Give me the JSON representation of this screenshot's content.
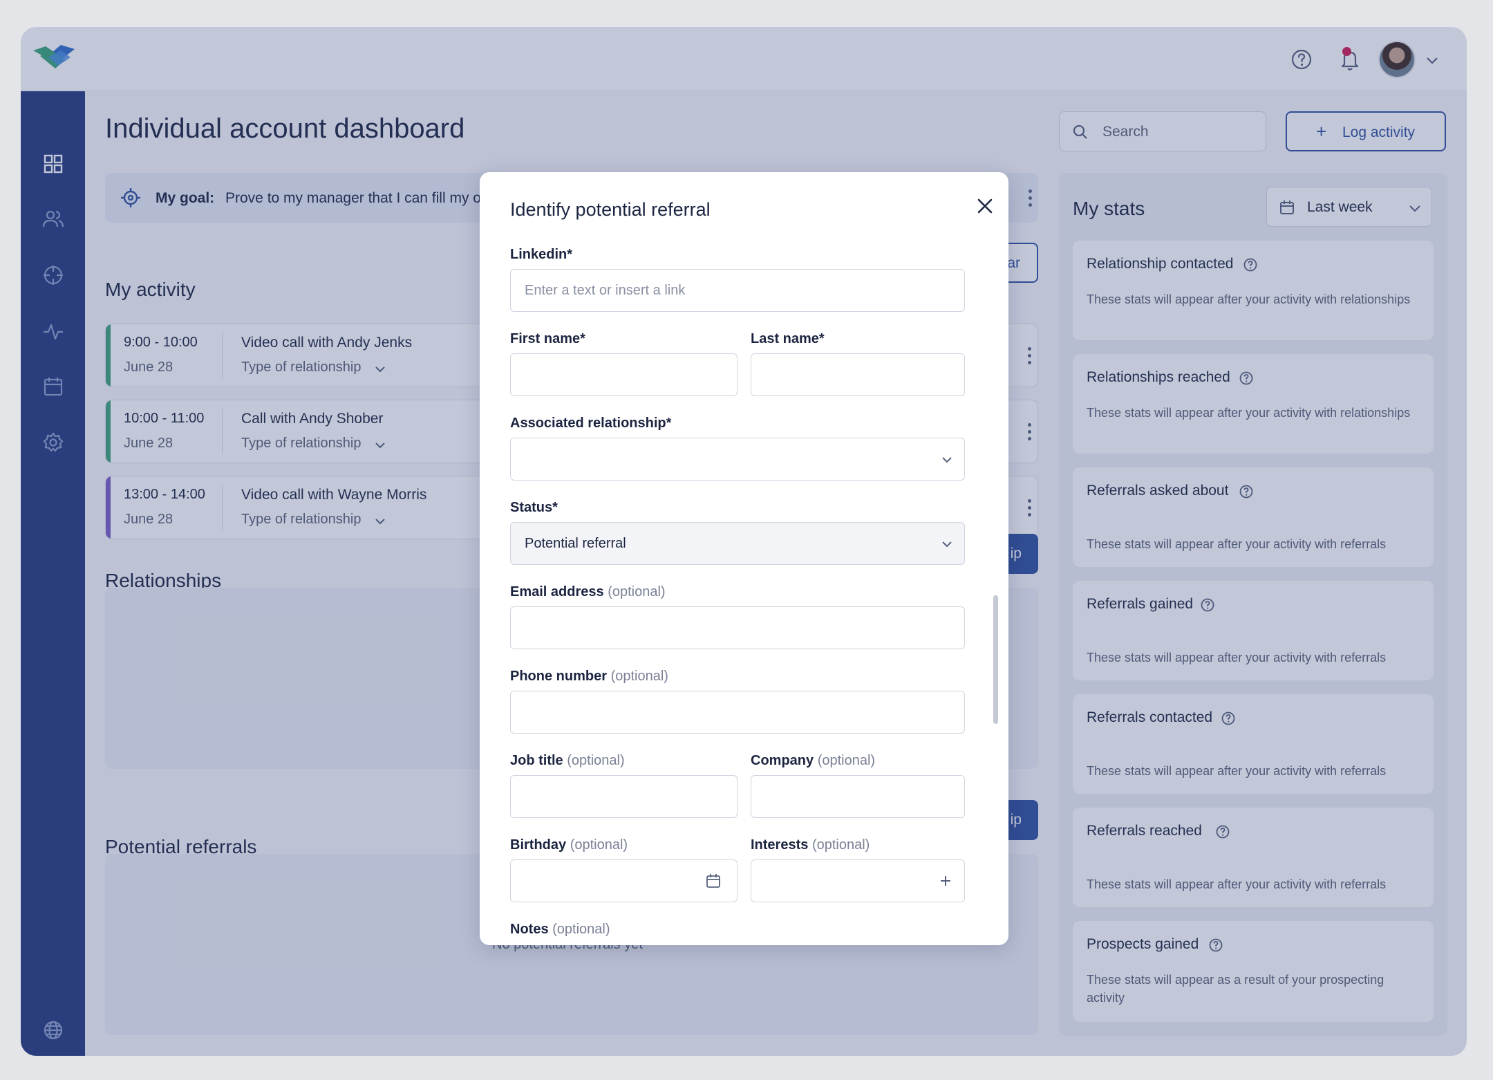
{
  "header": {
    "notification_dot_color": "#d11a55"
  },
  "sidebar": {
    "items": [
      {
        "icon": "dashboard-icon"
      },
      {
        "icon": "people-icon"
      },
      {
        "icon": "target-icon"
      },
      {
        "icon": "activity-icon"
      },
      {
        "icon": "calendar-icon"
      },
      {
        "icon": "gear-icon"
      },
      {
        "icon": "globe-icon"
      }
    ]
  },
  "main": {
    "title": "Individual account dashboard",
    "search_placeholder": "Search",
    "log_activity_label": "Log activity",
    "goal": {
      "label": "My goal:",
      "text": "Prove to my manager that I can fill my ov"
    },
    "activity": {
      "title": "My activity",
      "calendar_button_fragment": "ar",
      "items": [
        {
          "time": "9:00 - 10:00",
          "date": "June 28",
          "name": "Video call with Andy Jenks",
          "relationship": "Type of relationship",
          "color": "#3ea37a"
        },
        {
          "time": "10:00 - 11:00",
          "date": "June 28",
          "name": "Call with Andy Shober",
          "relationship": "Type of relationship",
          "color": "#3ea37a"
        },
        {
          "time": "13:00 - 14:00",
          "date": "June 28",
          "name": "Video call with Wayne Morris",
          "relationship": "Type of relationship",
          "color": "#7b5cc4"
        }
      ]
    },
    "relationships": {
      "title": "Relationships",
      "button_fragment": "ip"
    },
    "potential_referrals": {
      "title": "Potential referrals",
      "button_fragment": "ip",
      "empty_text": "No potential referrals yet"
    }
  },
  "stats": {
    "title": "My stats",
    "period": "Last week",
    "cards": [
      {
        "title": "Relationship contacted",
        "desc": "These stats will appear after your activity with relationships"
      },
      {
        "title": "Relationships reached",
        "desc": "These stats will appear after your activity with relationships"
      },
      {
        "title": "Referrals asked about",
        "desc": "These stats will appear after your activity with referrals"
      },
      {
        "title": "Referrals gained",
        "desc": "These stats will appear after your activity with referrals"
      },
      {
        "title": "Referrals contacted",
        "desc": "These stats will appear after your activity with referrals"
      },
      {
        "title": "Referrals reached",
        "desc": "These stats will appear after your activity with referrals"
      },
      {
        "title": "Prospects gained",
        "desc": "These stats will appear as a result of your prospecting activity"
      }
    ]
  },
  "modal": {
    "title": "Identify potential referral",
    "optional_tag": "(optional)",
    "linkedin": {
      "label": "Linkedin*",
      "placeholder": "Enter a text or insert a link"
    },
    "first_name": {
      "label": "First name*"
    },
    "last_name": {
      "label": "Last name*"
    },
    "associated_relationship": {
      "label": "Associated relationship*"
    },
    "status": {
      "label": "Status*",
      "value": "Potential referral"
    },
    "email": {
      "label": "Email address"
    },
    "phone": {
      "label": "Phone number"
    },
    "job_title": {
      "label": "Job title"
    },
    "company": {
      "label": "Company"
    },
    "birthday": {
      "label": "Birthday"
    },
    "interests": {
      "label": "Interests"
    },
    "notes": {
      "label": "Notes"
    }
  }
}
